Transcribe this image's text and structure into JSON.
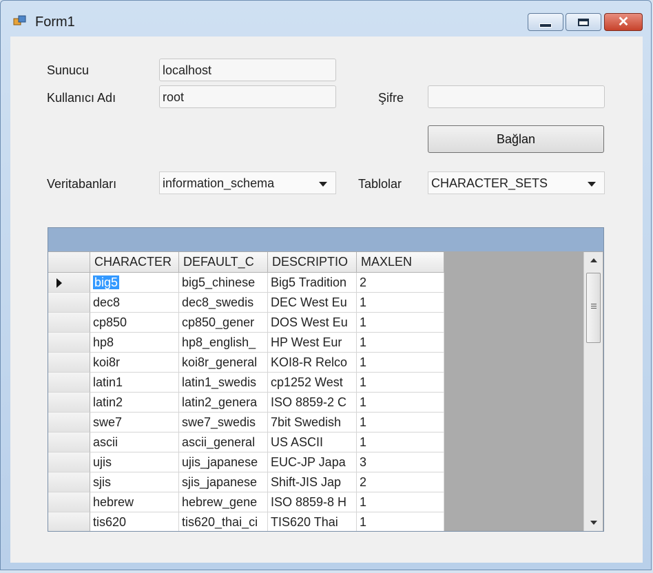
{
  "window": {
    "title": "Form1"
  },
  "form": {
    "server_label": "Sunucu",
    "server_value": "localhost",
    "user_label": "Kullanıcı Adı",
    "user_value": "root",
    "password_label": "Şifre",
    "password_value": "",
    "connect_button": "Bağlan",
    "databases_label": "Veritabanları",
    "databases_selected": "information_schema",
    "tables_label": "Tablolar",
    "tables_selected": "CHARACTER_SETS"
  },
  "grid": {
    "columns": [
      "CHARACTER",
      "DEFAULT_C",
      "DESCRIPTIO",
      "MAXLEN"
    ],
    "rows": [
      [
        "big5",
        "big5_chinese",
        "Big5 Tradition",
        "2"
      ],
      [
        "dec8",
        "dec8_swedis",
        "DEC West Eu",
        "1"
      ],
      [
        "cp850",
        "cp850_gener",
        "DOS West Eu",
        "1"
      ],
      [
        "hp8",
        "hp8_english_",
        "HP West Eur",
        "1"
      ],
      [
        "koi8r",
        "koi8r_general",
        "KOI8-R Relco",
        "1"
      ],
      [
        "latin1",
        "latin1_swedis",
        "cp1252 West",
        "1"
      ],
      [
        "latin2",
        "latin2_genera",
        "ISO 8859-2 C",
        "1"
      ],
      [
        "swe7",
        "swe7_swedis",
        "7bit Swedish",
        "1"
      ],
      [
        "ascii",
        "ascii_general",
        "US ASCII",
        "1"
      ],
      [
        "ujis",
        "ujis_japanese",
        "EUC-JP Japa",
        "3"
      ],
      [
        "sjis",
        "sjis_japanese",
        "Shift-JIS Jap",
        "2"
      ],
      [
        "hebrew",
        "hebrew_gene",
        "ISO 8859-8 H",
        "1"
      ],
      [
        "tis620",
        "tis620_thai_ci",
        "TIS620 Thai",
        "1"
      ]
    ]
  }
}
